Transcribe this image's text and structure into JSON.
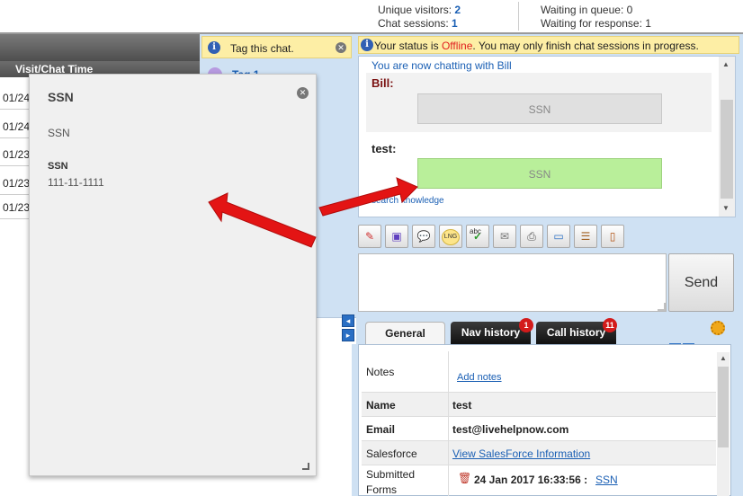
{
  "topbar": {
    "unique_visitors_label": "Unique visitors:",
    "unique_visitors_value": "2",
    "chat_sessions_label": "Chat sessions:",
    "chat_sessions_value": "1",
    "waiting_queue": "Waiting in queue: 0",
    "waiting_response": "Waiting for response: 1"
  },
  "visits": {
    "header": "Visit/Chat Time",
    "rows": [
      "01/24",
      "01/24",
      "01/23",
      "01/23",
      "01/23"
    ]
  },
  "tag": {
    "label": "Tag this chat.",
    "first_tag": "Tag 1"
  },
  "popup": {
    "title": "SSN",
    "subtitle": "SSN",
    "field_label": "SSN",
    "field_value": "111-11-1111"
  },
  "status": {
    "prefix": "Your status is ",
    "state": "Offline",
    "suffix": ". You may only finish chat sessions in progress."
  },
  "chat": {
    "intro": "You are now chatting with Bill",
    "messages": [
      {
        "sender": "Bill:",
        "text": "SSN"
      },
      {
        "sender": "test:",
        "text": "SSN"
      }
    ],
    "search_link": "search knowledge"
  },
  "toolbar": {
    "icons": [
      "eraser-icon",
      "save-icon",
      "chat-bubbles-icon",
      "language-icon",
      "spellcheck-icon",
      "email-icon",
      "print-icon",
      "screen-share-icon",
      "notes-icon",
      "exit-door-icon"
    ],
    "lng_label": "LNG",
    "abc_label": "abc"
  },
  "send_label": "Send",
  "tabs": [
    {
      "label": "General",
      "badge": ""
    },
    {
      "label": "Nav history",
      "badge": "1"
    },
    {
      "label": "Call history",
      "badge": "11"
    }
  ],
  "info": {
    "notes_label": "Notes",
    "add_notes": "Add notes",
    "name_label": "Name",
    "name_value": "test",
    "email_label": "Email",
    "email_value": "test@livehelpnow.com",
    "salesforce_label": "Salesforce",
    "salesforce_link": "View SalesForce Information",
    "forms_label_1": "Submitted",
    "forms_label_2": "Forms",
    "form_date": "24 Jan 2017 16:33:56 :",
    "form_link": "SSN"
  },
  "colors": {
    "accent_blue": "#1a5fb4",
    "offline_red": "#e02020",
    "status_bg": "#fdeea5",
    "panel_bg": "#cfe1f3",
    "bubble_agent": "#b9ef9a",
    "bubble_visitor": "#e0e0e0",
    "arrow_red": "#e31414"
  }
}
